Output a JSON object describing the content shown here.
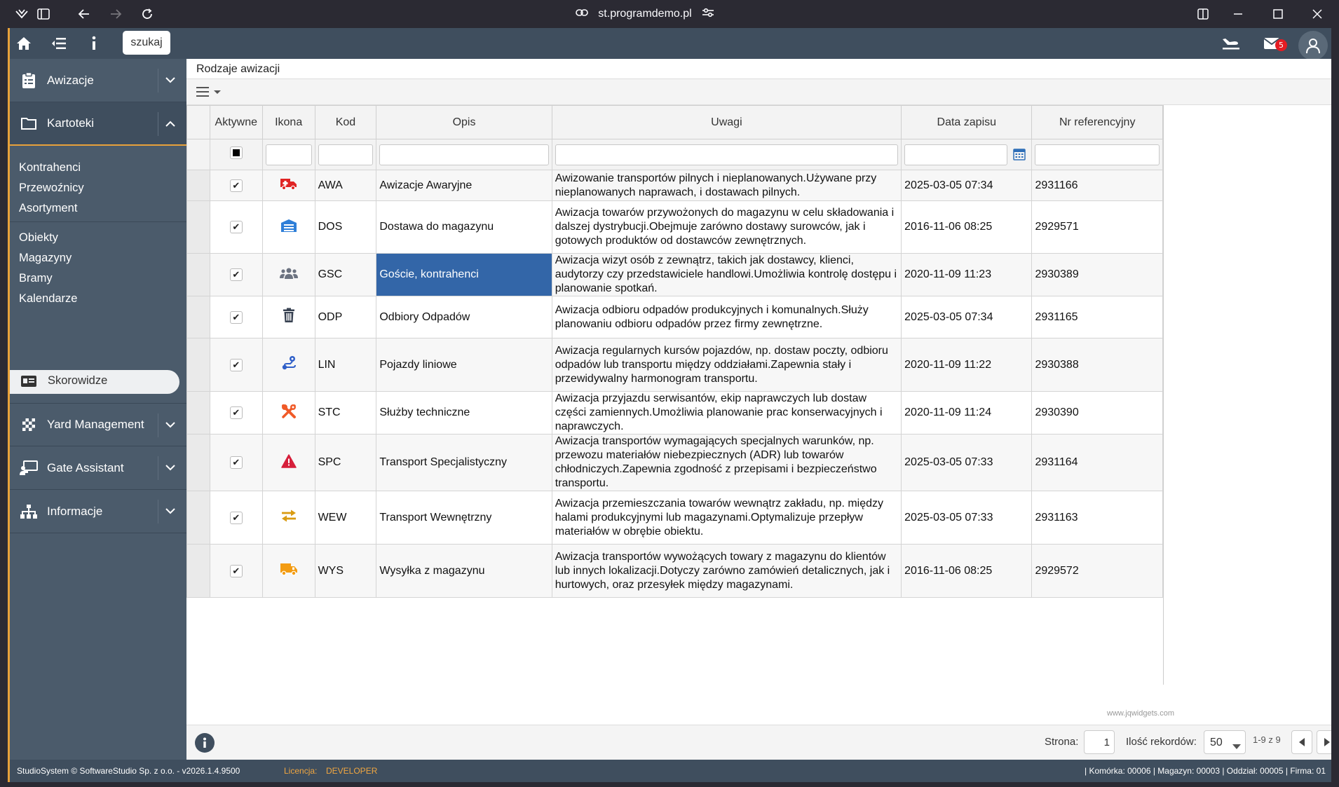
{
  "browser": {
    "url": "st.programdemo.pl"
  },
  "topbar": {
    "search_label": "szukaj",
    "mail_count": "5"
  },
  "sidebar": {
    "sections": [
      {
        "label": "Awizacje"
      },
      {
        "label": "Kartoteki"
      },
      {
        "label": "Yard Management"
      },
      {
        "label": "Gate Assistant"
      },
      {
        "label": "Informacje"
      }
    ],
    "sub_items": [
      {
        "label": "Kontrahenci"
      },
      {
        "label": "Przewoźnicy"
      },
      {
        "label": "Asortyment"
      },
      {
        "label": "Obiekty"
      },
      {
        "label": "Magazyny"
      },
      {
        "label": "Bramy"
      },
      {
        "label": "Kalendarze"
      },
      {
        "label": "Skorowidze"
      }
    ]
  },
  "page": {
    "title": "Rodzaje awizacji"
  },
  "grid": {
    "columns": [
      "Aktywne",
      "Ikona",
      "Kod",
      "Opis",
      "Uwagi",
      "Data zapisu",
      "Nr referencyjny"
    ],
    "rows": [
      {
        "icon": "ambulance-icon",
        "color": "#e02424",
        "kod": "AWA",
        "opis": "Awizacje Awaryjne",
        "uwagi": "Awizowanie transportów pilnych i nieplanowanych.Używane przy nieplanowanych naprawach, i dostawach pilnych.",
        "data": "2025-03-05 07:34",
        "nr": "2931166"
      },
      {
        "icon": "warehouse-icon",
        "color": "#2f7fd8",
        "kod": "DOS",
        "opis": "Dostawa do magazynu",
        "uwagi": "Awizacja towarów przywożonych do magazynu w celu składowania i dalszej dystrybucji.Obejmuje zarówno dostawy surowców, jak i gotowych produktów od dostawców zewnętrznych.",
        "data": "2016-11-06 08:25",
        "nr": "2929571"
      },
      {
        "icon": "users-icon",
        "color": "#6b7280",
        "kod": "GSC",
        "opis": "Goście, kontrahenci",
        "uwagi": "Awizacja wizyt osób z zewnątrz, takich jak dostawcy, klienci, audytorzy czy przedstawiciele handlowi.Umożliwia kontrolę dostępu i planowanie spotkań.",
        "data": "2020-11-09 11:23",
        "nr": "2930389"
      },
      {
        "icon": "trash-icon",
        "color": "#374151",
        "kod": "ODP",
        "opis": "Odbiory Odpadów",
        "uwagi": "Awizacja odbioru odpadów produkcyjnych i komunalnych.Służy planowaniu odbioru odpadów przez firmy zewnętrzne.",
        "data": "2025-03-05 07:34",
        "nr": "2931165"
      },
      {
        "icon": "route-icon",
        "color": "#2f5fc8",
        "kod": "LIN",
        "opis": "Pojazdy liniowe",
        "uwagi": "Awizacja regularnych kursów pojazdów, np. dostaw poczty, odbioru odpadów lub transportu między oddziałami.Zapewnia stały i przewidywalny harmonogram transportu.",
        "data": "2020-11-09 11:22",
        "nr": "2930388"
      },
      {
        "icon": "tools-icon",
        "color": "#f05a28",
        "kod": "STC",
        "opis": "Służby techniczne",
        "uwagi": "Awizacja przyjazdu serwisantów, ekip naprawczych lub dostaw części zamiennych.Umożliwia planowanie prac konserwacyjnych i naprawczych.",
        "data": "2020-11-09 11:24",
        "nr": "2930390"
      },
      {
        "icon": "warning-icon",
        "color": "#d61f3b",
        "kod": "SPC",
        "opis": "Transport Specjalistyczny",
        "uwagi": "Awizacja transportów wymagających specjalnych warunków, np. przewozu materiałów niebezpiecznych (ADR) lub towarów chłodniczych.Zapewnia zgodność z przepisami i bezpieczeństwo transportu.",
        "data": "2025-03-05 07:33",
        "nr": "2931164"
      },
      {
        "icon": "arrows-exchange-icon",
        "color": "#d99b12",
        "kod": "WEW",
        "opis": "Transport Wewnętrzny",
        "uwagi": "Awizacja przemieszczania towarów wewnątrz zakładu, np. między halami produkcyjnymi lub magazynami.Optymalizuje przepływ materiałów w obrębie obiektu.",
        "data": "2025-03-05 07:33",
        "nr": "2931163"
      },
      {
        "icon": "truck-icon",
        "color": "#f39c12",
        "kod": "WYS",
        "opis": "Wysyłka z magazynu",
        "uwagi": "Awizacja transportów wywożących towary z magazynu do klientów lub innych lokalizacji.Dotyczy zarówno zamówień detalicznych, jak i hurtowych, oraz przesyłek między magazynami.",
        "data": "2016-11-06 08:25",
        "nr": "2929572"
      }
    ]
  },
  "watermark": "www.jqwidgets.com",
  "pager": {
    "page_label": "Strona:",
    "page_value": "1",
    "records_label": "Ilość rekordów:",
    "records_value": "50",
    "range": "1-9 z 9"
  },
  "status": {
    "left": "StudioSystem © SoftwareStudio Sp. z o.o. - v2026.1.4.9500",
    "license_label": "Licencja:",
    "license_value": "DEVELOPER",
    "right": "| Komórka: 00006 | Magazyn: 00003 | Oddział: 00005 | Firma: 01"
  }
}
